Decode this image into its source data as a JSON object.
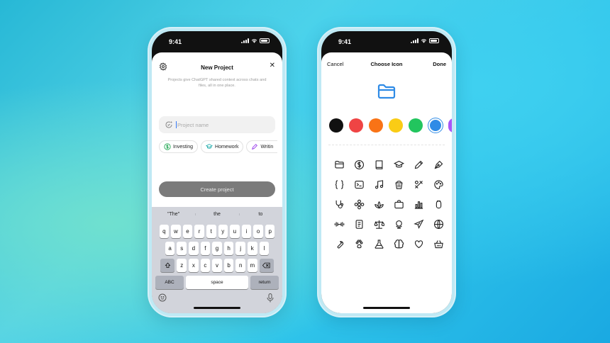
{
  "left_phone": {
    "status_time": "9:41",
    "title": "New Project",
    "description": "Projects give ChatGPT shared context across chats and files, all in one place.",
    "name_input_placeholder": "Project name",
    "chips": [
      {
        "label": "Investing",
        "icon": "dollar-circle-icon",
        "color": "#16a34a"
      },
      {
        "label": "Homework",
        "icon": "graduation-cap-icon",
        "color": "#0ea5a4"
      },
      {
        "label": "Writin",
        "icon": "pen-icon",
        "color": "#9333ea"
      }
    ],
    "create_button_label": "Create project",
    "keyboard": {
      "suggestions": [
        "\"The\"",
        "the",
        "to"
      ],
      "row1": [
        "q",
        "w",
        "e",
        "r",
        "t",
        "y",
        "u",
        "i",
        "o",
        "p"
      ],
      "row2": [
        "a",
        "s",
        "d",
        "f",
        "g",
        "h",
        "j",
        "k",
        "l"
      ],
      "row3": [
        "z",
        "x",
        "c",
        "v",
        "b",
        "n",
        "m"
      ],
      "abc_label": "ABC",
      "space_label": "space",
      "return_label": "return"
    }
  },
  "right_phone": {
    "status_time": "9:41",
    "cancel_label": "Cancel",
    "title": "Choose Icon",
    "done_label": "Done",
    "selected_icon": "folder-icon",
    "accent_color": "#2f8be6",
    "colors": [
      {
        "name": "black",
        "hex": "#111111"
      },
      {
        "name": "red",
        "hex": "#ef4444"
      },
      {
        "name": "orange",
        "hex": "#f97316"
      },
      {
        "name": "yellow",
        "hex": "#facc15"
      },
      {
        "name": "green",
        "hex": "#22c55e"
      },
      {
        "name": "blue",
        "hex": "#2f8be6",
        "selected": true
      },
      {
        "name": "purple",
        "hex": "#a855f7"
      }
    ],
    "icons": [
      "folder-icon",
      "dollar-circle-icon",
      "book-icon",
      "graduation-cap-icon",
      "pencil-icon",
      "pen-nib-icon",
      "code-braces-icon",
      "terminal-icon",
      "music-note-icon",
      "bucket-icon",
      "tools-icon",
      "palette-icon",
      "stethoscope-icon",
      "flower-icon",
      "lotus-icon",
      "briefcase-icon",
      "bar-chart-icon",
      "bag-icon",
      "dumbbell-icon",
      "document-icon",
      "scales-icon",
      "globe-stand-icon",
      "airplane-icon",
      "globe-icon",
      "wrench-icon",
      "paw-icon",
      "flask-icon",
      "brain-icon",
      "heart-icon",
      "basket-icon"
    ]
  }
}
